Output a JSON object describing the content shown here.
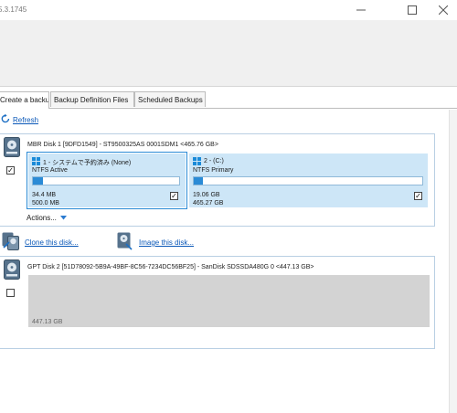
{
  "window": {
    "title": "5.3.1745"
  },
  "tabs": [
    {
      "label": "Create a backup",
      "active": true
    },
    {
      "label": "Backup Definition Files",
      "active": false
    },
    {
      "label": "Scheduled Backups",
      "active": false
    }
  ],
  "toolbar": {
    "refresh_label": "Refresh"
  },
  "disk1": {
    "header": "MBR Disk 1 [9DFD1549] - ST9500325AS 0001SDM1  <465.76 GB>",
    "checked": true,
    "partitions": [
      {
        "title": "1 - システムで予約済み (None)",
        "fs": "NTFS Active",
        "used": "34.4 MB",
        "total": "500.0 MB",
        "usage": 0.068,
        "checked": true
      },
      {
        "title": "2 - (C:)",
        "fs": "NTFS Primary",
        "used": "19.06 GB",
        "total": "465.27 GB",
        "usage": 0.041,
        "checked": true
      }
    ],
    "actions_label": "Actions...",
    "clone_label": "Clone this disk...",
    "image_label": "Image this disk..."
  },
  "disk2": {
    "header": "GPT Disk 2 [51D78092-5B9A-49BF-8C56-7234DC56BF25] - SanDisk  SDSSDA480G       0  <447.13 GB>",
    "checked": false,
    "unallocated_size": "447.13 GB"
  },
  "colors": {
    "accent": "#0b58b8",
    "partition_bg": "#cde6f7",
    "usage_fill": "#2b8bd6",
    "selection_border": "#2b8bd6"
  }
}
